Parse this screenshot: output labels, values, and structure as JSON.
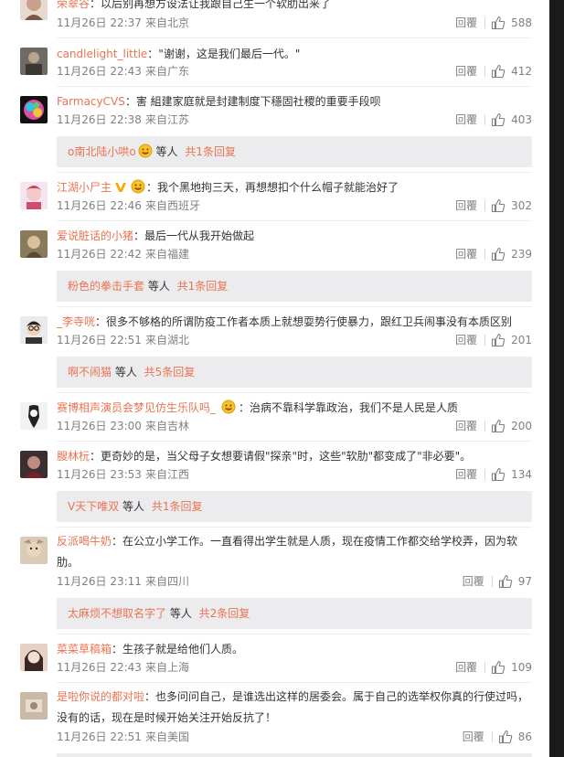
{
  "common": {
    "reply_label": "回覆"
  },
  "comments": [
    {
      "user": "荣翠谷",
      "text": "以后别再想方设法让我跟自己生一个软肋出来了",
      "time": "11月26日 22:37",
      "loc": "来自北京",
      "likes": "588"
    },
    {
      "user": "candlelight_little",
      "text": "\"谢谢，这是我们最后一代。\"",
      "time": "11月26日 22:43",
      "loc": "来自广东",
      "likes": "412"
    },
    {
      "user": "FarmacyCVS",
      "text": "害 組建家庭就是封建制度下穩固社稷的重要手段呗",
      "time": "11月26日 22:38",
      "loc": "来自江苏",
      "likes": "403",
      "sub": {
        "name": "o南北陆小哄o",
        "mid": " 等人 ",
        "more": "共1条回复"
      }
    },
    {
      "user": "江湖小尸主",
      "text": "我个黑地拘三天，再想想扣个什么帽子就能治好了",
      "time": "11月26日 22:46",
      "loc": "来自西班牙",
      "likes": "302"
    },
    {
      "user": "爱说脏话的小猪",
      "text": "最后一代从我开始做起",
      "time": "11月26日 22:42",
      "loc": "来自福建",
      "likes": "239",
      "sub": {
        "name": "粉色的拳击手套",
        "mid": " 等人 ",
        "more": "共1条回复"
      }
    },
    {
      "user": "_李寺咣",
      "text": "很多不够格的所谓防疫工作者本质上就想耍势行使暴力，跟红卫兵闹事没有本质区别",
      "time": "11月26日 22:51",
      "loc": "来自湖北",
      "likes": "201",
      "sub": {
        "name": "啊不闹猫",
        "mid": " 等人 ",
        "more": "共5条回复"
      }
    },
    {
      "user": "赛博相声演员会梦见仿生乐队吗_",
      "text": "治病不靠科学靠政治，我们不是人民是人质",
      "time": "11月26日 23:00",
      "loc": "来自吉林",
      "likes": "200"
    },
    {
      "user": "膄林杬",
      "text": "更奇妙的是，当父母子女想要请假\"探亲\"时，这些\"软肋\"都变成了\"非必要\"。",
      "time": "11月26日 23:53",
      "loc": "来自江西",
      "likes": "134",
      "sub": {
        "name": "V天下唯双",
        "mid": " 等人 ",
        "more": "共1条回复"
      }
    },
    {
      "user": "反派喝牛奶",
      "text": "在公立小学工作。一直看得出学生就是人质，现在疫情工作都交给学校弄，因为软肋。",
      "time": "11月26日 23:11",
      "loc": "来自四川",
      "likes": "97",
      "sub": {
        "name": "太麻烦不想取名字了",
        "mid": " 等人 ",
        "more": "共2条回复"
      }
    },
    {
      "user": "菜菜草稿箱",
      "text": "生孩子就是给他们人质。",
      "time": "11月26日 22:43",
      "loc": "来自上海",
      "likes": "109"
    },
    {
      "user": "是啦你说的都对啦",
      "text": "也多问问自己，是谁选出这样的居委会。属于自己的选举权你真的行使过吗，没有的话，现在是时候开始关注开始反抗了！",
      "time": "11月26日 22:51",
      "loc": "来自美国",
      "likes": "86"
    }
  ],
  "colors": {
    "username": "#eb7350",
    "meta": "#808080",
    "sub_bg": "#ececef",
    "vip": "#ffa500"
  },
  "icons": {
    "like": "thumbs-up-icon",
    "vip": "vip-v-icon",
    "emoji": "smiley-emoji-icon"
  }
}
